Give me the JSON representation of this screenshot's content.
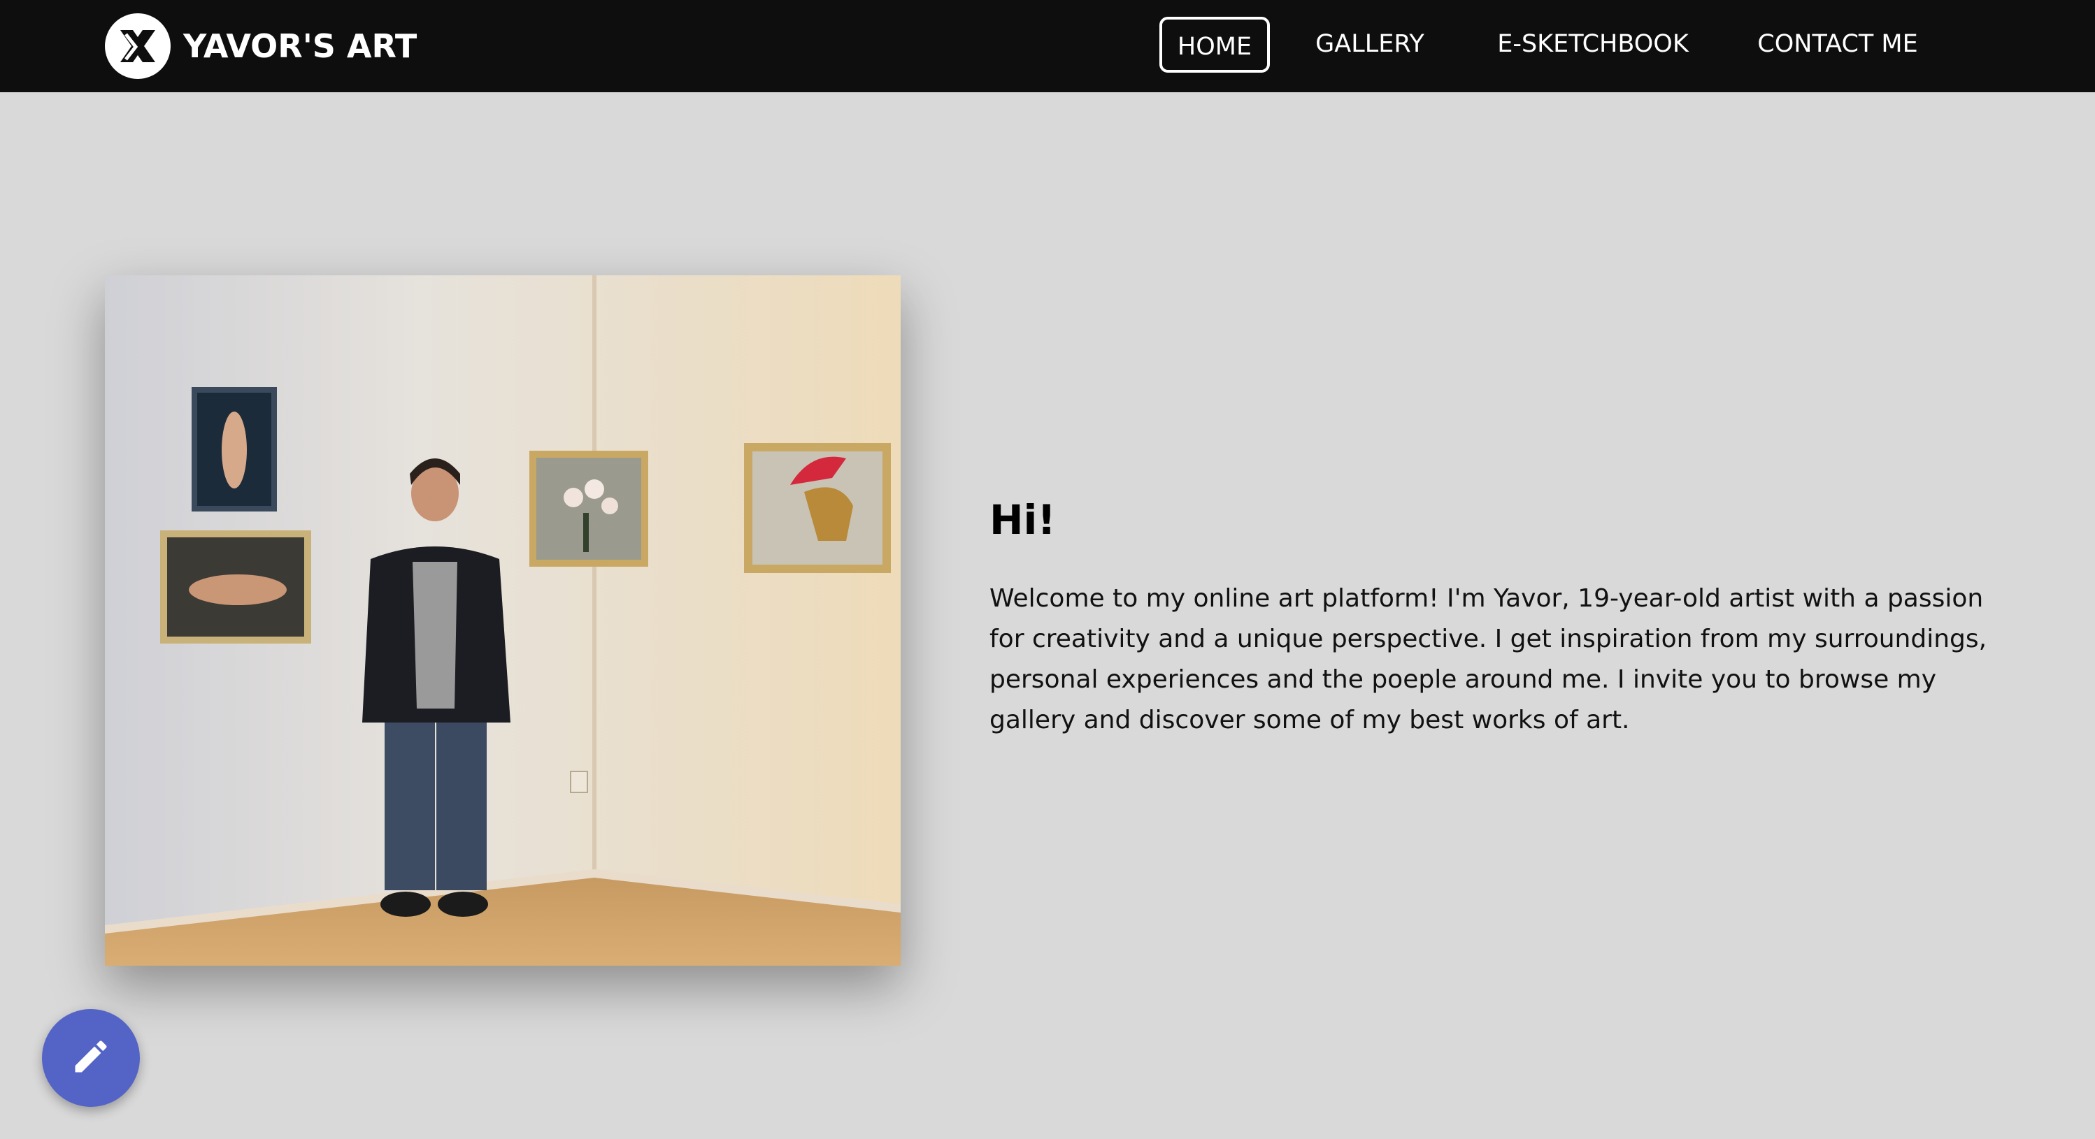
{
  "header": {
    "brand_name": "YAVOR'S ART",
    "logo_icon": "yx-monogram-icon",
    "nav": [
      {
        "label": "HOME",
        "active": true
      },
      {
        "label": "GALLERY",
        "active": false
      },
      {
        "label": "E-SKETCHBOOK",
        "active": false
      },
      {
        "label": "CONTACT ME",
        "active": false
      }
    ]
  },
  "main": {
    "photo_alt": "Young man standing in front of framed paintings on a wall",
    "greeting": "Hi!",
    "intro": "Welcome to my online art platform! I'm Yavor, 19-year-old artist with a passion for creativity and a unique perspective. I get inspiration from my surroundings, personal experiences and the poeple around me. I invite you to browse my gallery and discover some of my best works of art."
  },
  "fab": {
    "icon": "pencil-icon"
  },
  "colors": {
    "header_bg": "#0e0e0e",
    "page_bg": "#d9d9d9",
    "fab_bg": "#5463c6"
  }
}
